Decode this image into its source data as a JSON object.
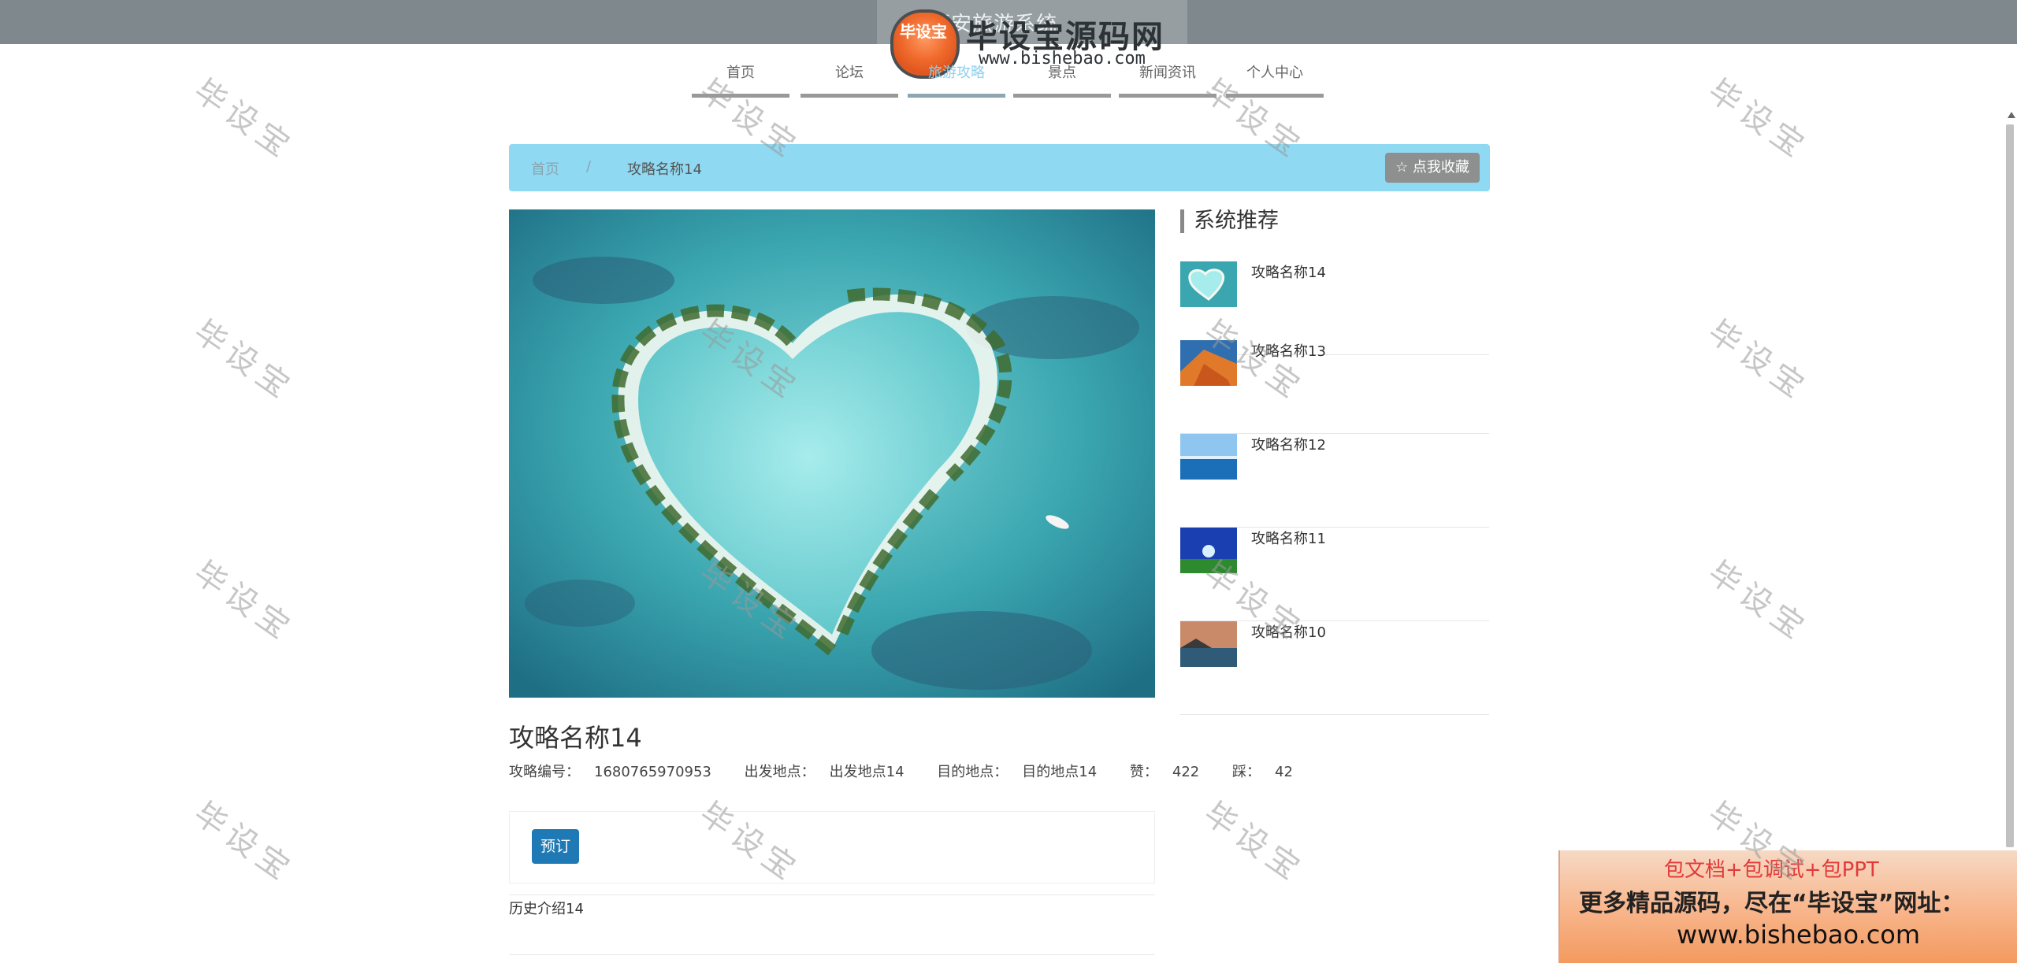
{
  "header": {
    "site_title": "西安旅游系统",
    "logo_mark": "毕设宝",
    "logo_text": "毕设宝源码网",
    "logo_url": "www.bishebao.com"
  },
  "nav": {
    "items": [
      {
        "label": "首页"
      },
      {
        "label": "论坛"
      },
      {
        "label": "旅游攻略"
      },
      {
        "label": "景点"
      },
      {
        "label": "新闻资讯"
      },
      {
        "label": "个人中心"
      }
    ]
  },
  "breadcrumb": {
    "home": "首页",
    "sep": "/",
    "current": "攻略名称14",
    "fav_label": "☆ 点我收藏"
  },
  "detail": {
    "title": "攻略名称14",
    "code_label": "攻略编号：",
    "code": "1680765970953",
    "from_label": "出发地点：",
    "from": "出发地点14",
    "to_label": "目的地点：",
    "to": "目的地点14",
    "like_label": "赞：",
    "like": "422",
    "dislike_label": "踩：",
    "dislike": "42",
    "book_label": "预订",
    "history": "历史介绍14"
  },
  "recommend": {
    "title": "系统推荐",
    "items": [
      {
        "name": "攻略名称14"
      },
      {
        "name": "攻略名称13"
      },
      {
        "name": "攻略名称12"
      },
      {
        "name": "攻略名称11"
      },
      {
        "name": "攻略名称10"
      }
    ]
  },
  "promo": {
    "line1": "包文档+包调试+包PPT",
    "line2": "更多精品源码，尽在“毕设宝”网址：",
    "line3": "www.bishebao.com"
  },
  "watermark": "毕设宝"
}
